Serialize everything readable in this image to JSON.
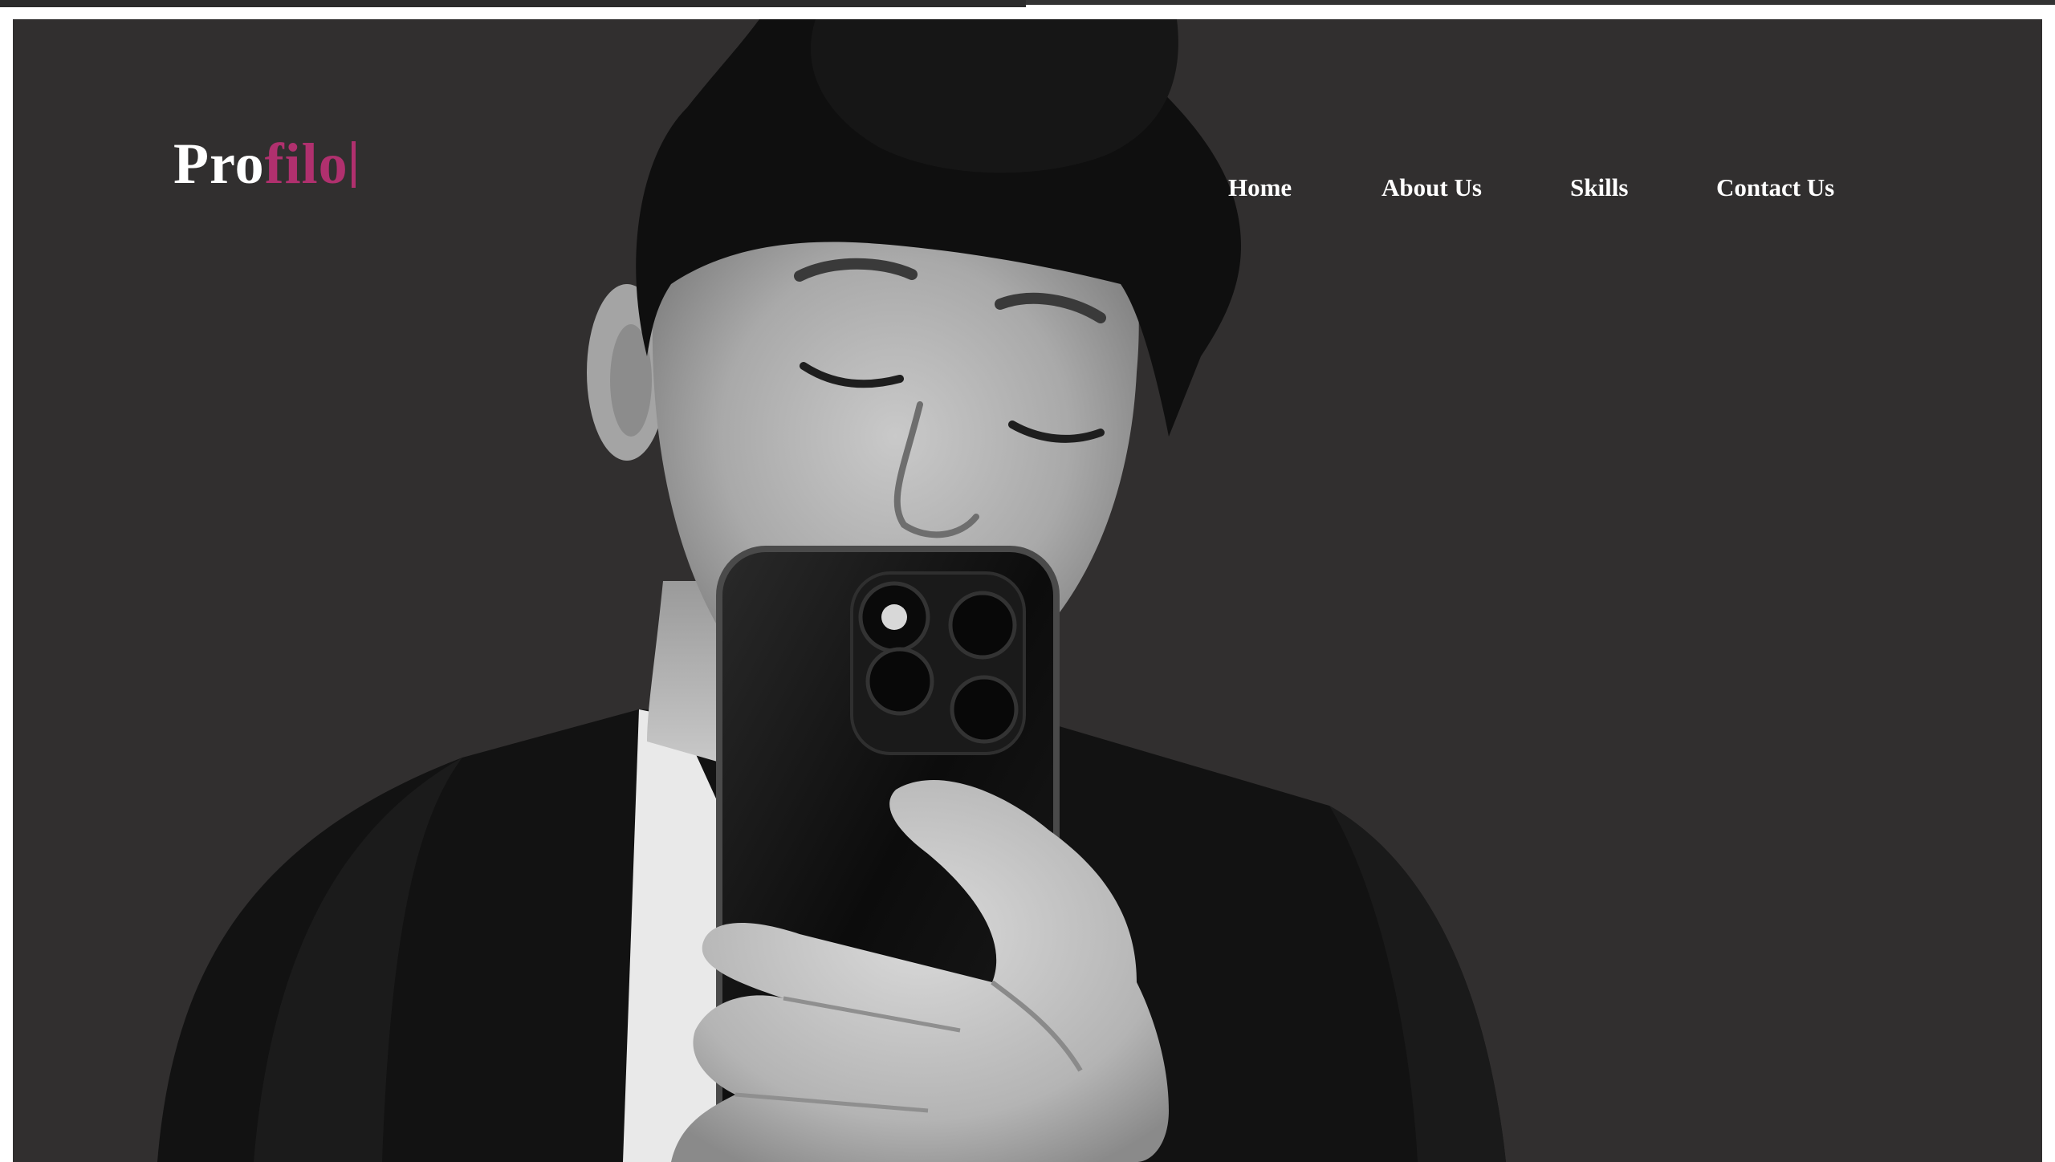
{
  "brand": {
    "prefix": "Pro",
    "accent": "filo",
    "prefix_color": "#ffffff",
    "accent_color": "#b0306e"
  },
  "nav": {
    "items": [
      {
        "label": "Home"
      },
      {
        "label": "About Us"
      },
      {
        "label": "Skills"
      },
      {
        "label": "Contact Us"
      }
    ]
  },
  "hero": {
    "background_color": "#312f2f",
    "image": "grayscale portrait photo of man in suit holding phone"
  }
}
